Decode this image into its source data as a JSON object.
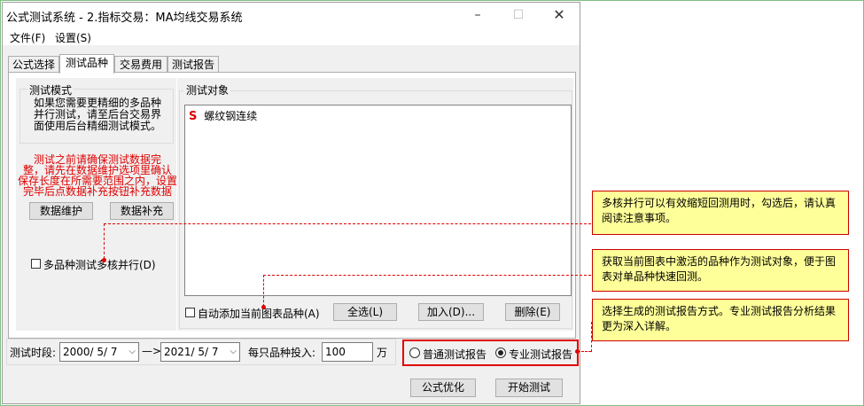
{
  "window": {
    "title": "公式测试系统 - 2.指标交易：MA均线交易系统"
  },
  "menu": [
    "文件(F)",
    "设置(S)"
  ],
  "tabs": [
    "公式选择",
    "测试品种",
    "交易费用",
    "测试报告"
  ],
  "test_mode": {
    "title": "测试模式",
    "description_lines": [
      "如果您需要更精细的多品种",
      "并行测试，请至后台交易界",
      "面使用后台精细测试模式。"
    ],
    "warning_lines": [
      "测试之前请确保测试数据完",
      "整，请先在数据维护选项里确认",
      "保存长度在所需要范围之内，设置",
      "完毕后点数据补充按钮补充数据"
    ],
    "maintain_btn": "数据维护",
    "supplement_btn": "数据补充",
    "multicore_label": "多品种测试多核并行(D)"
  },
  "objects": {
    "title": "测试对象",
    "items": [
      {
        "prefix": "S",
        "name": "螺纹钢连续"
      }
    ],
    "auto_add_label": "自动添加当前图表品种(A)",
    "select_all_btn": "全选(L)",
    "add_btn": "加入(D)...",
    "delete_btn": "删除(E)"
  },
  "period": {
    "label": "测试时段:",
    "start": "2000/ 5/ 7",
    "arrow": "—>",
    "end": "2021/ 5/ 7",
    "invest_label": "每只品种投入:",
    "invest_value": "100",
    "unit": "万"
  },
  "report_type": {
    "normal": "普通测试报告",
    "pro": "专业测试报告",
    "selected": "pro"
  },
  "buttons": {
    "optimize": "公式优化",
    "start": "开始测试"
  },
  "callouts": [
    "多核并行可以有效缩短回测用时，勾选后，请认真阅读注意事项。",
    "获取当前图表中激活的品种作为测试对象，便于图表对单品种快速回测。",
    "选择生成的测试报告方式。专业测试报告分析结果更为深入详解。"
  ],
  "colors": {
    "accent_red": "#e00000",
    "callout_bg": "#ffff99",
    "frame_green": "#7fbf7f"
  }
}
